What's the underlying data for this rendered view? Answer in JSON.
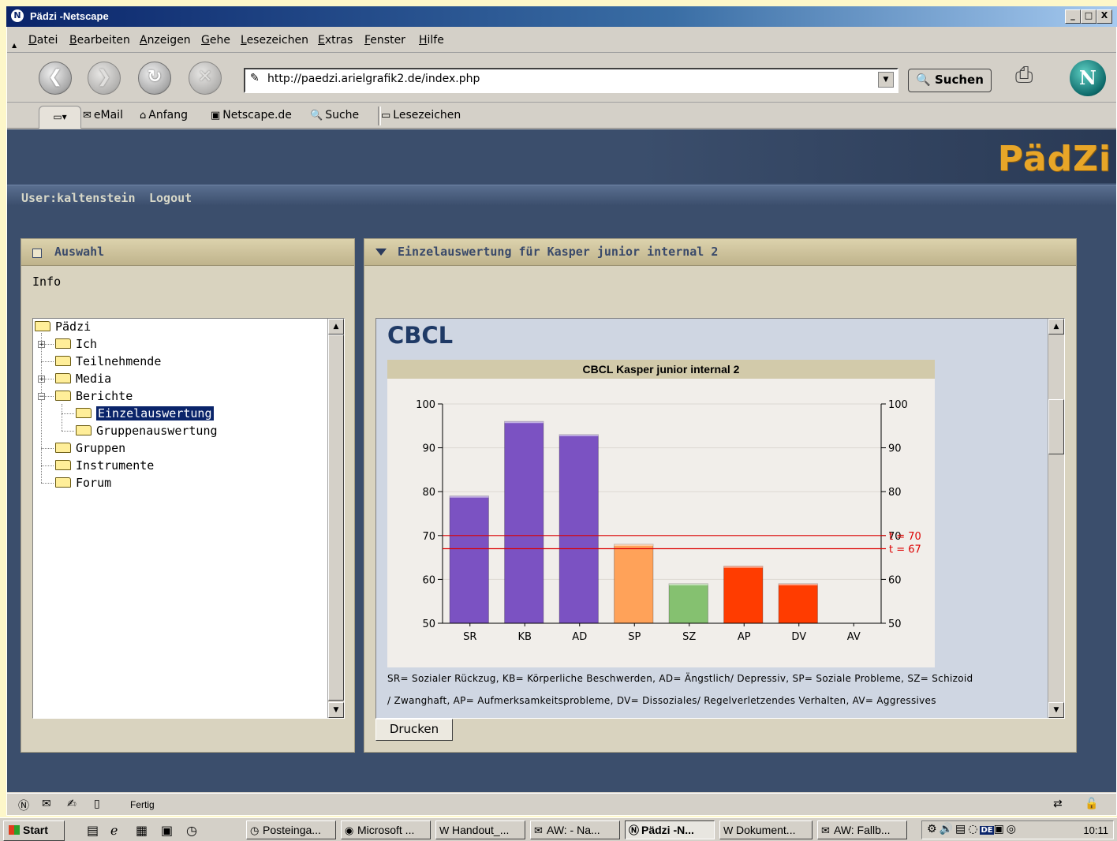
{
  "window": {
    "title": "Pädzi -Netscape",
    "buttons": [
      "_",
      "□",
      "X"
    ]
  },
  "menu": [
    "Datei",
    "Bearbeiten",
    "Anzeigen",
    "Gehe",
    "Lesezeichen",
    "Extras",
    "Fenster",
    "Hilfe"
  ],
  "navbar": {
    "url": "http://paedzi.arielgrafik2.de/index.php",
    "search_label": "Suchen"
  },
  "personal_toolbar": {
    "items": [
      "eMail",
      "Anfang",
      "Netscape.de",
      "Suche",
      "Lesezeichen"
    ]
  },
  "site": {
    "brand": "PädZi",
    "user_label": "User:kaltenstein",
    "logout_label": "Logout"
  },
  "left_panel": {
    "title": "Auswahl",
    "info": "Info",
    "tree": {
      "root": "Pädzi",
      "items": [
        "Ich",
        "Teilnehmende",
        "Media",
        "Berichte",
        "Einzelauswertung",
        "Gruppenauswertung",
        "Gruppen",
        "Instrumente",
        "Forum"
      ],
      "selected": "Einzelauswertung"
    }
  },
  "right_panel": {
    "title": "Einzelauswertung für Kasper junior internal 2",
    "section_title": "CBCL",
    "legend_line1": "SR= Sozialer Rückzug, KB= Körperliche Beschwerden, AD= Ängstlich/ Depressiv, SP= Soziale Probleme, SZ= Schizoid",
    "legend_line2": "/ Zwanghaft, AP= Aufmerksamkeitsprobleme, DV= Dissoziales/ Regelverletzendes Verhalten, AV= Aggressives",
    "print_label": "Drucken"
  },
  "chart_data": {
    "type": "bar",
    "title": "CBCL Kasper junior internal 2",
    "categories": [
      "SR",
      "KB",
      "AD",
      "SP",
      "SZ",
      "AP",
      "DV",
      "AV"
    ],
    "values": [
      79,
      96,
      93,
      68,
      59,
      63,
      59,
      null
    ],
    "colors": [
      "#7b52c2",
      "#7b52c2",
      "#7b52c2",
      "#ffa259",
      "#85c170",
      "#ff3c00",
      "#ff3c00",
      "#ff3c00"
    ],
    "ylim": [
      50,
      100
    ],
    "yticks": [
      50,
      60,
      70,
      80,
      90,
      100
    ],
    "reference_lines": [
      {
        "label": "t = 70",
        "value": 70,
        "color": "#dd0000"
      },
      {
        "label": "t = 67",
        "value": 67,
        "color": "#dd0000"
      }
    ],
    "dual_y_axis": true
  },
  "statusbar": {
    "text": "Fertig"
  },
  "taskbar": {
    "start": "Start",
    "tasks": [
      "Posteinga...",
      "Microsoft ...",
      "Handout_...",
      "AW:  - Na...",
      "Pädzi -N...",
      "Dokument...",
      "AW: Fallb..."
    ],
    "active_task": "Pädzi -N...",
    "language": "DE",
    "clock": "10:11"
  }
}
